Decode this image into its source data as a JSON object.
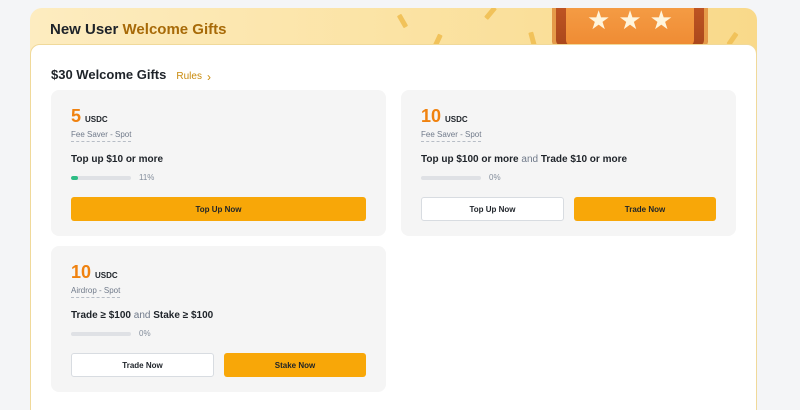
{
  "banner": {
    "title_prefix": "New User ",
    "title_highlight": "Welcome Gifts"
  },
  "section": {
    "title": "$30 Welcome Gifts",
    "rules_label": "Rules"
  },
  "cards": [
    {
      "amount": "5",
      "unit": "USDC",
      "subtitle": "Fee Saver - Spot",
      "task_a": "Top up $10 or more",
      "progress_pct_label": "11%",
      "progress_fraction": 0.11,
      "buttons": [
        {
          "label": "Top Up Now",
          "style": "primary"
        }
      ]
    },
    {
      "amount": "10",
      "unit": "USDC",
      "subtitle": "Fee Saver - Spot",
      "task_a": "Top up $100 or more",
      "task_join": "and",
      "task_b": "Trade $10 or more",
      "progress_pct_label": "0%",
      "progress_fraction": 0,
      "buttons": [
        {
          "label": "Top Up Now",
          "style": "outline"
        },
        {
          "label": "Trade Now",
          "style": "primary"
        }
      ]
    },
    {
      "amount": "10",
      "unit": "USDC",
      "subtitle": "Airdrop - Spot",
      "task_a": "Trade ≥ $100",
      "task_join": "and",
      "task_b": "Stake ≥ $100",
      "progress_pct_label": "0%",
      "progress_fraction": 0,
      "buttons": [
        {
          "label": "Trade Now",
          "style": "outline"
        },
        {
          "label": "Stake Now",
          "style": "primary"
        }
      ]
    }
  ],
  "colors": {
    "accent": "#f8a708",
    "amount": "#f0820f",
    "progress": "#2ebd85",
    "rules": "#c98a0b"
  },
  "icons": {
    "rules_chevron": "chevron-right-icon",
    "gift_stars": "star-icon"
  }
}
